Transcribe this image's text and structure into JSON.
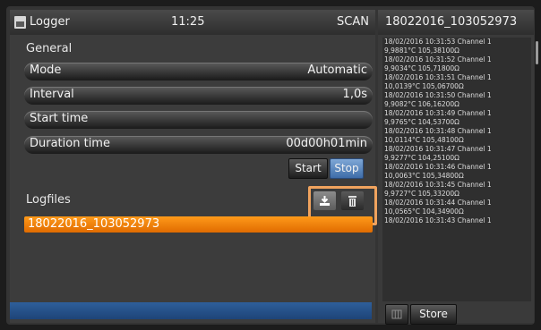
{
  "header": {
    "title": "Logger",
    "time": "11:25",
    "mode_label": "SCAN"
  },
  "general": {
    "section_title": "General",
    "mode": {
      "label": "Mode",
      "value": "Automatic"
    },
    "interval": {
      "label": "Interval",
      "value": "1,0s"
    },
    "start_time": {
      "label": "Start time",
      "value": ""
    },
    "duration_time": {
      "label": "Duration time",
      "value": "00d00h01min"
    }
  },
  "controls": {
    "start_label": "Start",
    "stop_label": "Stop"
  },
  "logfiles": {
    "section_title": "Logfiles",
    "items": [
      "18022016_103052973"
    ],
    "icons": [
      "download-icon",
      "trash-icon"
    ]
  },
  "right_panel": {
    "title": "18022016_103052973",
    "log_lines": [
      "18/02/2016 10:31:53 Channel 1",
      "9,9881°C 105,38100Ω",
      "18/02/2016 10:31:52 Channel 1",
      "9,9034°C 105,71800Ω",
      "18/02/2016 10:31:51 Channel 1",
      "10,0139°C 105,06700Ω",
      "18/02/2016 10:31:50 Channel 1",
      "9,9082°C 106,16200Ω",
      "18/02/2016 10:31:49 Channel 1",
      "9,9765°C 104,53700Ω",
      "18/02/2016 10:31:48 Channel 1",
      "10,0114°C 105,48100Ω",
      "18/02/2016 10:31:47 Channel 1",
      "9,9277°C 104,25100Ω",
      "18/02/2016 10:31:46 Channel 1",
      "10,0063°C 105,34800Ω",
      "18/02/2016 10:31:45 Channel 1",
      "9,9727°C 105,33200Ω",
      "18/02/2016 10:31:44 Channel 1",
      "10,0565°C 104,34900Ω",
      "18/02/2016 10:31:43 Channel 1"
    ],
    "store_label": "Store"
  },
  "colors": {
    "accent": "#ff8c00",
    "highlight": "#f0a35e",
    "stop_button": "#5b8bc7",
    "status_bar": "#2a5a94"
  }
}
